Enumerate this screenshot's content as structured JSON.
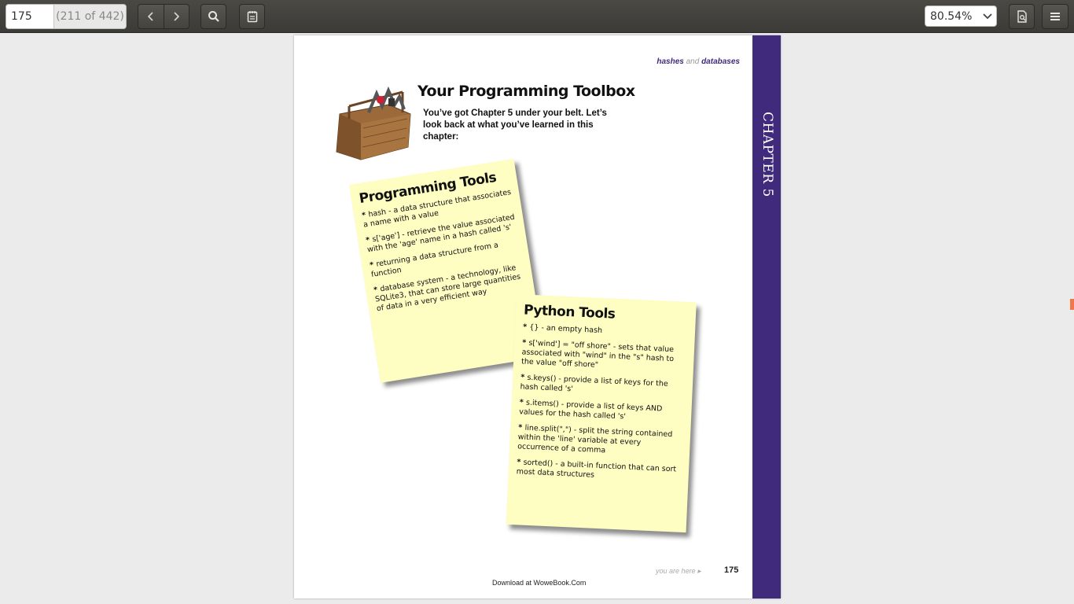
{
  "toolbar": {
    "page_input_value": "175",
    "page_total": "(211 of 442)",
    "zoom_value": "80.54%"
  },
  "page": {
    "running_head": {
      "part1": "hashes",
      "and": "and",
      "part2": "databases"
    },
    "chapter_tab": "CHAPTER 5",
    "title": "Your Programming Toolbox",
    "intro": "You’ve got Chapter 5 under your belt. Let’s look back at what you’ve learned in this chapter:",
    "note_programming": {
      "title": "Programming Tools",
      "items": [
        "hash - a data structure that associates a name with a value",
        "s['age'] - retrieve the value associated with the 'age' name in a hash called 's'",
        "returning a data structure from a function",
        "database system - a technology, like SQLite3, that can store large quantities of data in a very efficient way"
      ]
    },
    "note_python": {
      "title": "Python Tools",
      "items": [
        "{} - an empty hash",
        "s['wind'] = \"off shore\" - sets that value associated with \"wind\" in the \"s\" hash to the value \"off shore\"",
        "s.keys() - provide a list of keys for the hash called 's'",
        "s.items() - provide a list of keys AND values for the hash called 's'",
        "line.split(\",\") - split the string contained within the 'line' variable at every occurrence of a comma",
        "sorted() - a built-in function that can sort most data structures"
      ]
    },
    "footer_you_are_here": "you are here ▸",
    "page_number": "175",
    "download_text": "Download at WoweBook.Com"
  }
}
